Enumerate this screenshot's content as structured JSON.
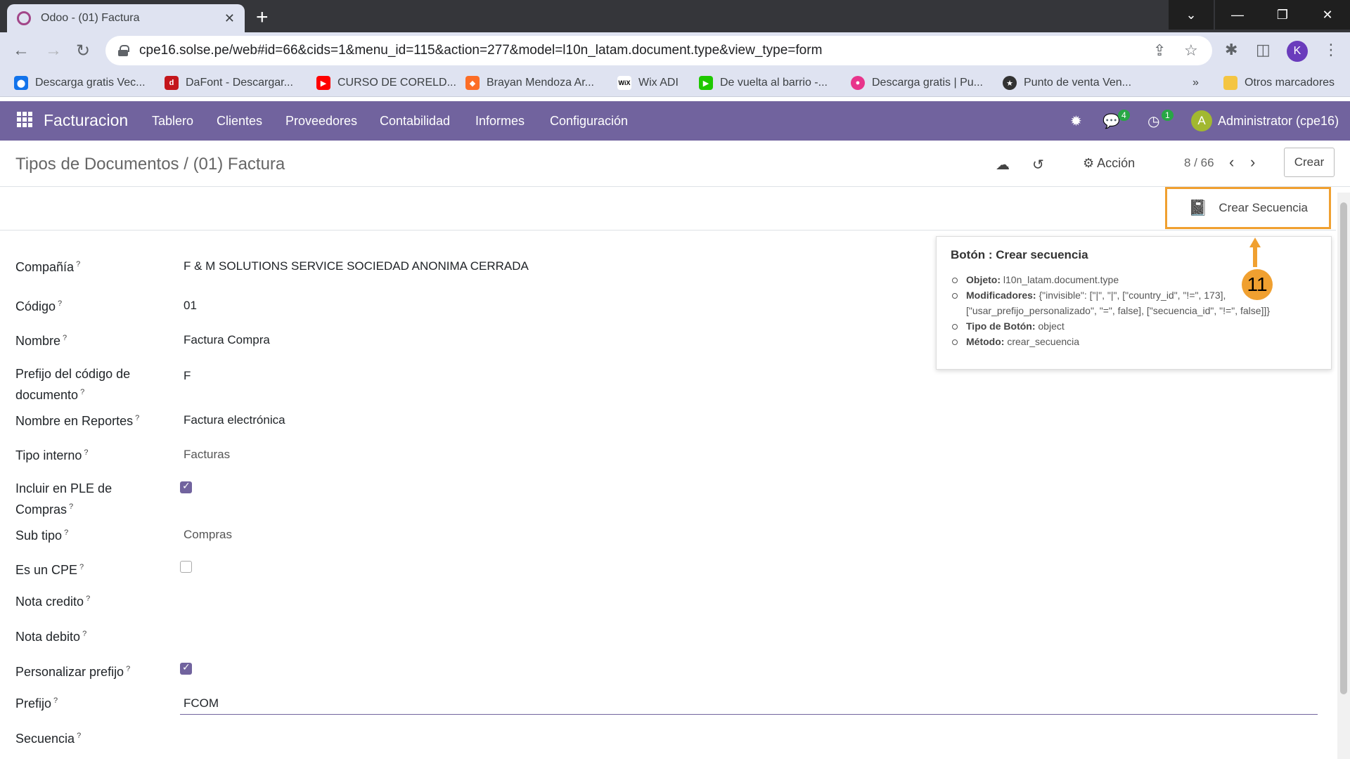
{
  "browser": {
    "tab_title": "Odoo - (01) Factura",
    "tab_close": "✕",
    "new_tab": "+",
    "url": "cpe16.solse.pe/web#id=66&cids=1&menu_id=115&action=277&model=l10n_latam.document.type&view_type=form",
    "profile_initial": "K",
    "bookmarks": [
      {
        "label": "Descarga gratis Vec...",
        "icon": "freepik-icon",
        "color": "#1273eb"
      },
      {
        "label": "DaFont - Descargar...",
        "icon": "dafont-icon",
        "color": "#c4161c"
      },
      {
        "label": "CURSO DE CORELD...",
        "icon": "youtube-icon",
        "color": "#ff0000"
      },
      {
        "label": "Brayan Mendoza Ar...",
        "icon": "gitlab-icon",
        "color": "#fc6d26"
      },
      {
        "label": "Wix ADI",
        "icon": "wix-icon",
        "color": "#000000"
      },
      {
        "label": "De vuelta al barrio -...",
        "icon": "play-icon",
        "color": "#1ec800"
      },
      {
        "label": "Descarga gratis | Pu...",
        "icon": "drop-icon",
        "color": "#e8348b"
      },
      {
        "label": "Punto de venta Ven...",
        "icon": "star-badge-icon",
        "color": "#333333"
      }
    ],
    "more_bookmarks": "»",
    "other_bookmarks": "Otros marcadores"
  },
  "navbar": {
    "brand": "Facturacion",
    "menus": [
      "Tablero",
      "Clientes",
      "Proveedores",
      "Contabilidad",
      "Informes",
      "Configuración"
    ],
    "messages_badge": "4",
    "activities_badge": "1",
    "avatar_initial": "A",
    "user": "Administrator (cpe16)"
  },
  "control_panel": {
    "breadcrumb": "Tipos de Documentos / (01) Factura",
    "action": "Acción",
    "pager": "8 / 66",
    "create": "Crear"
  },
  "header": {
    "crear_secuencia": "Crear Secuencia"
  },
  "form": {
    "company_label": "Compañía",
    "company_value": "F & M SOLUTIONS SERVICE SOCIEDAD ANONIMA CERRADA",
    "code_label": "Código",
    "code_value": "01",
    "name_label": "Nombre",
    "name_value": "Factura Compra",
    "prefix_doc_label_1": "Prefijo del código de",
    "prefix_doc_label_2": "documento",
    "prefix_doc_value": "F",
    "report_name_label": "Nombre en Reportes",
    "report_name_value": "Factura electrónica",
    "internal_type_label": "Tipo interno",
    "internal_type_value": "Facturas",
    "ple_label_1": "Incluir en PLE de",
    "ple_label_2": "Compras",
    "ple_checked": true,
    "subtype_label": "Sub tipo",
    "subtype_value": "Compras",
    "cpe_label": "Es un CPE",
    "cpe_checked": false,
    "credit_note_label": "Nota credito",
    "debit_note_label": "Nota debito",
    "custom_prefix_label": "Personalizar prefijo",
    "custom_prefix_checked": true,
    "prefix_label": "Prefijo",
    "prefix_value": "FCOM",
    "sequence_label": "Secuencia",
    "help_mark": "?"
  },
  "tooltip": {
    "title": "Botón : Crear secuencia",
    "object_label": "Objeto:",
    "object_value": "l10n_latam.document.type",
    "modifiers_label": "Modificadores:",
    "modifiers_value_1": "{\"invisible\": [\"|\", \"|\", [\"country_id\", \"!=\", 173],",
    "modifiers_value_2": "[\"usar_prefijo_personalizado\", \"=\", false], [\"secuencia_id\", \"!=\", false]]}",
    "button_type_label": "Tipo de Botón:",
    "button_type_value": "object",
    "method_label": "Método:",
    "method_value": "crear_secuencia"
  },
  "annotation": {
    "step": "11",
    "color": "#f0a030"
  }
}
